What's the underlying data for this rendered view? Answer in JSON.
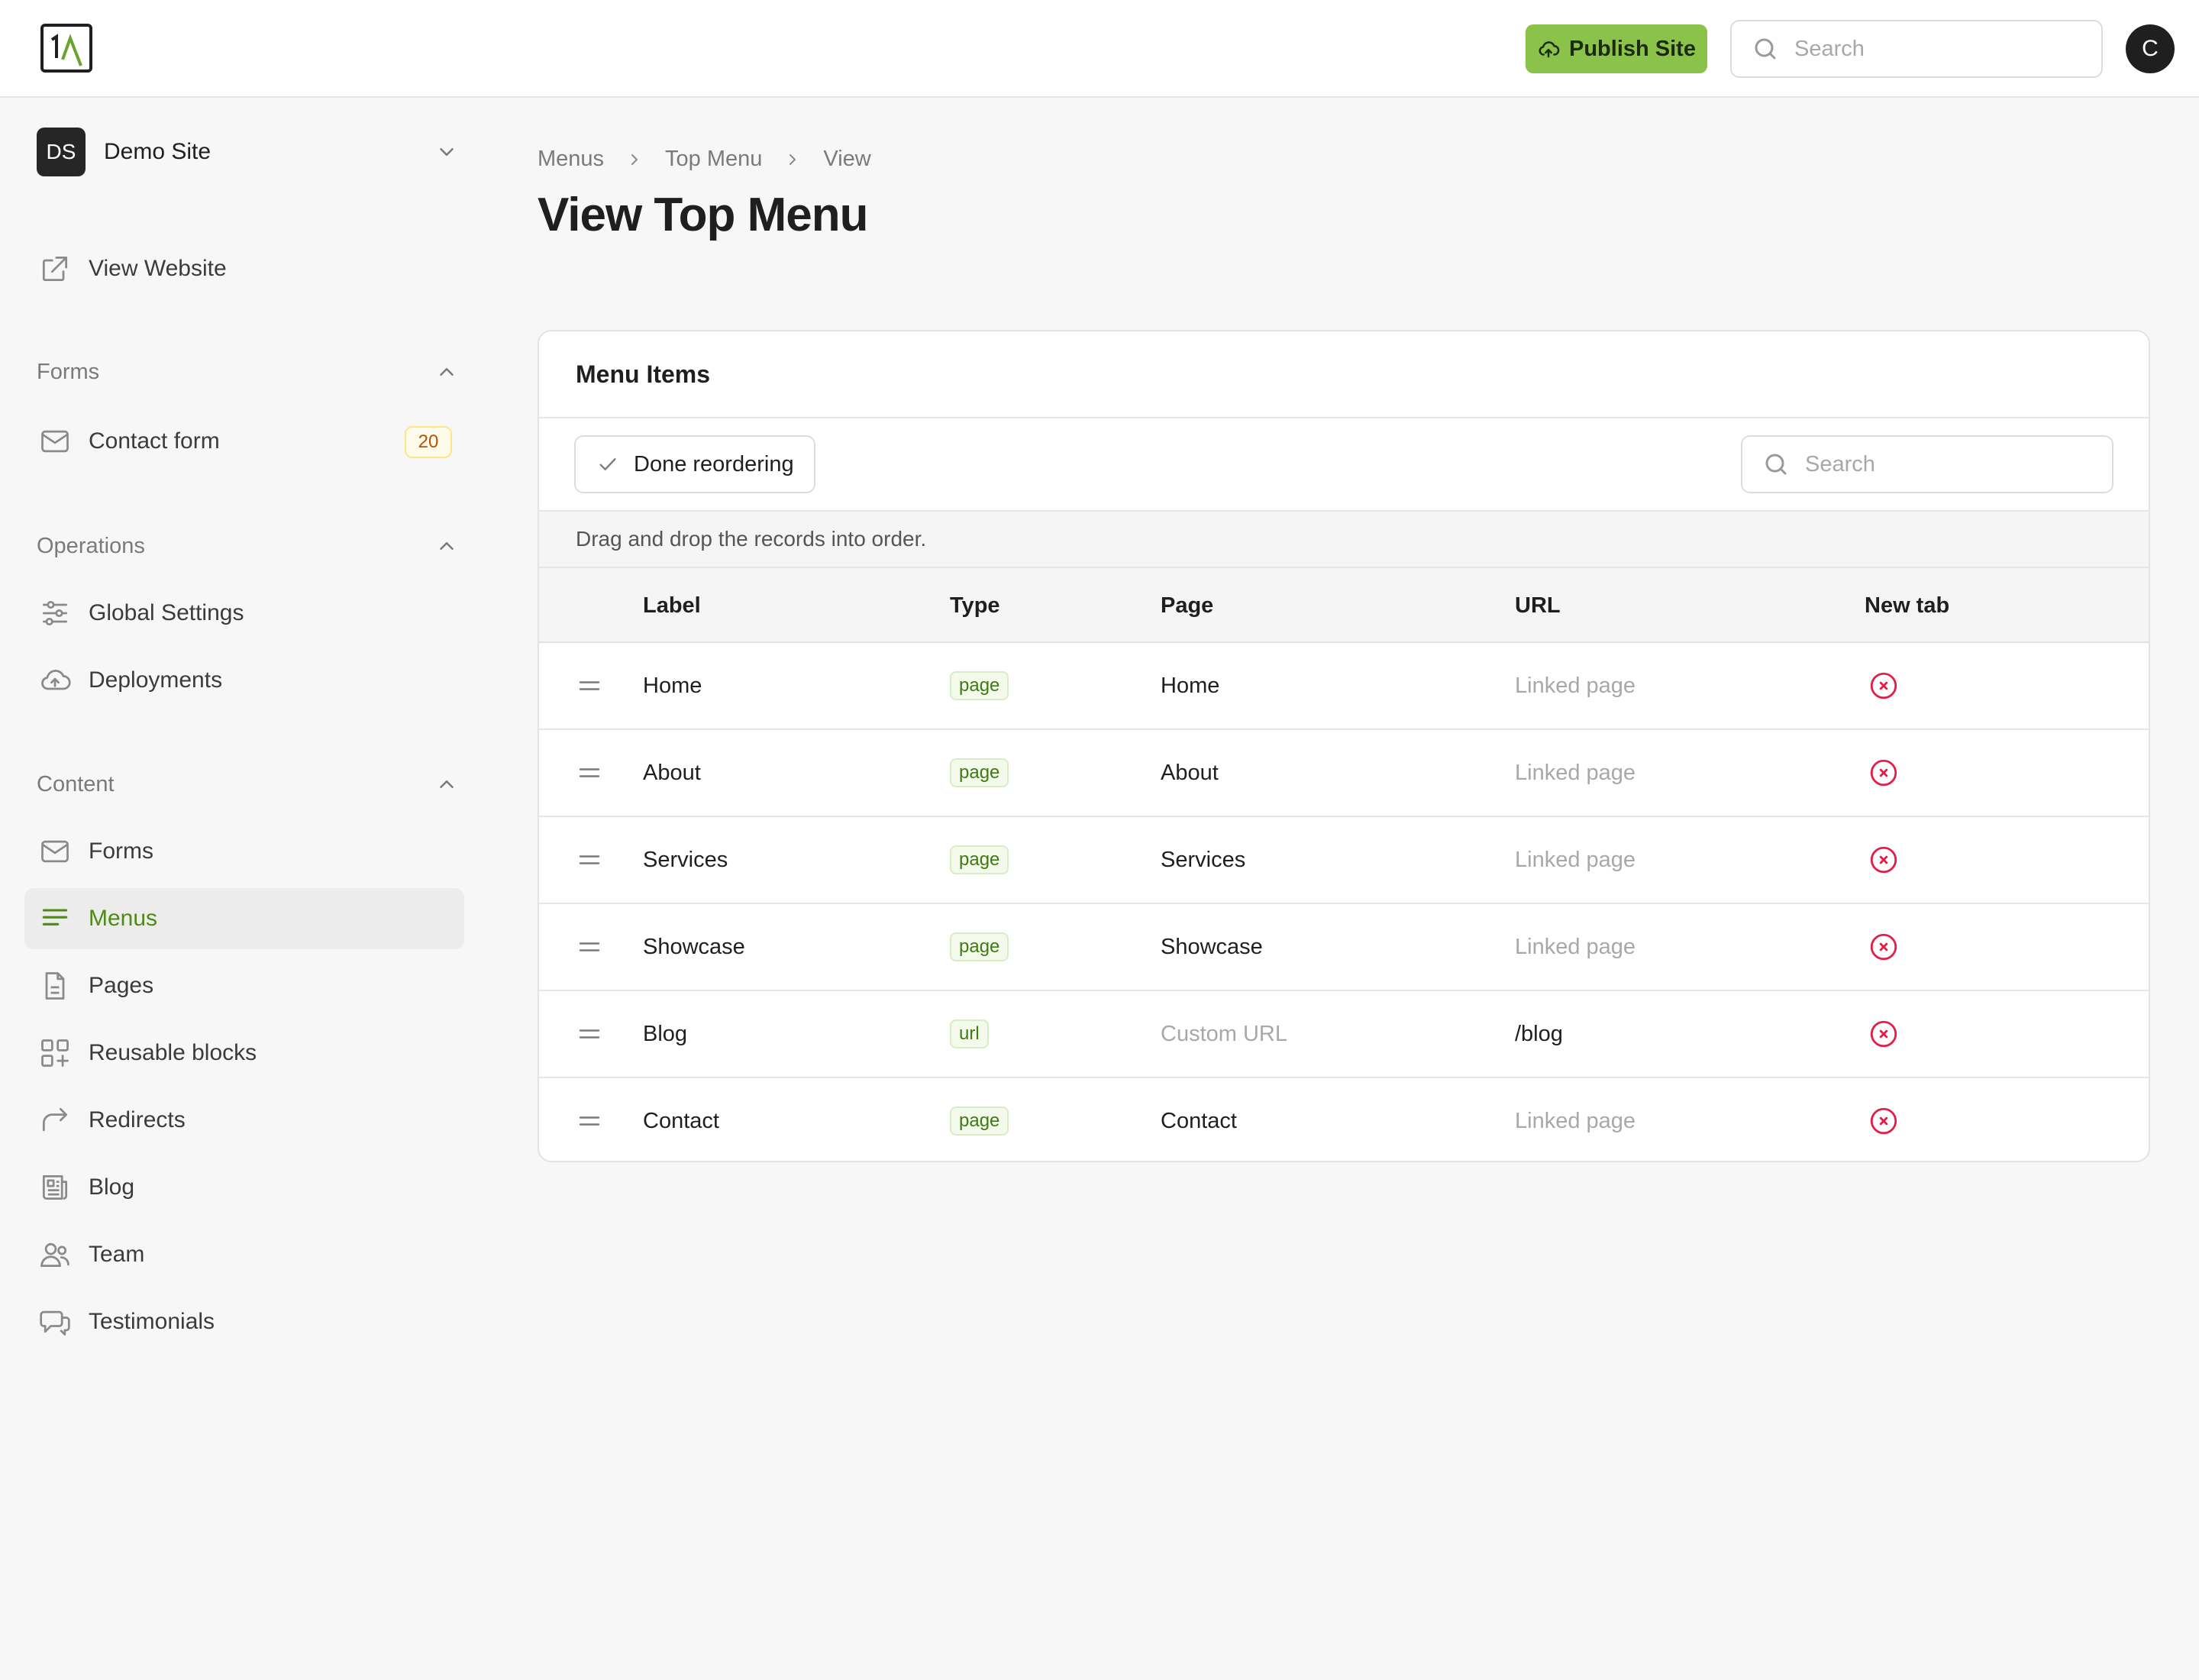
{
  "header": {
    "publish_label": "Publish Site",
    "search_placeholder": "Search",
    "avatar_initial": "C"
  },
  "sidebar": {
    "site": {
      "initials": "DS",
      "name": "Demo Site"
    },
    "view_website": "View Website",
    "groups": [
      {
        "label": "Forms",
        "items": [
          {
            "label": "Contact form",
            "icon": "mail-icon",
            "count": "20"
          }
        ]
      },
      {
        "label": "Operations",
        "items": [
          {
            "label": "Global Settings",
            "icon": "sliders-icon"
          },
          {
            "label": "Deployments",
            "icon": "cloud-upload-icon"
          }
        ]
      },
      {
        "label": "Content",
        "items": [
          {
            "label": "Forms",
            "icon": "mail-icon"
          },
          {
            "label": "Menus",
            "icon": "menu-lines-icon",
            "active": true
          },
          {
            "label": "Pages",
            "icon": "document-icon"
          },
          {
            "label": "Reusable blocks",
            "icon": "blocks-icon"
          },
          {
            "label": "Redirects",
            "icon": "redirect-arrow-icon"
          },
          {
            "label": "Blog",
            "icon": "newspaper-icon"
          },
          {
            "label": "Team",
            "icon": "users-icon"
          },
          {
            "label": "Testimonials",
            "icon": "chat-bubbles-icon"
          }
        ]
      }
    ]
  },
  "breadcrumb": [
    "Menus",
    "Top Menu",
    "View"
  ],
  "page_title": "View Top Menu",
  "card": {
    "title": "Menu Items",
    "done_label": "Done reordering",
    "search_placeholder": "Search",
    "hint": "Drag and drop the records into order.",
    "columns": [
      "Label",
      "Type",
      "Page",
      "URL",
      "New tab"
    ],
    "rows": [
      {
        "label": "Home",
        "type": "page",
        "page": "Home",
        "url": "Linked page",
        "new_tab": false
      },
      {
        "label": "About",
        "type": "page",
        "page": "About",
        "url": "Linked page",
        "new_tab": false
      },
      {
        "label": "Services",
        "type": "page",
        "page": "Services",
        "url": "Linked page",
        "new_tab": false
      },
      {
        "label": "Showcase",
        "type": "page",
        "page": "Showcase",
        "url": "Linked page",
        "new_tab": false
      },
      {
        "label": "Blog",
        "type": "url",
        "page": "Custom URL",
        "url": "/blog",
        "new_tab": false
      },
      {
        "label": "Contact",
        "type": "page",
        "page": "Contact",
        "url": "Linked page",
        "new_tab": false
      }
    ]
  },
  "colors": {
    "accent": "#8bc34a",
    "active_text": "#4e8a16",
    "danger": "#e11d48"
  }
}
